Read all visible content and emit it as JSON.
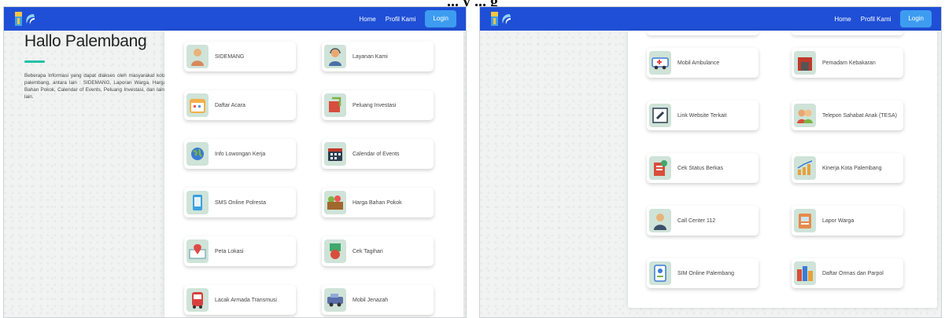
{
  "heading": "... y ... g",
  "left": {
    "nav": {
      "home": "Home",
      "profile": "Profil Kami",
      "login": "Login"
    },
    "intro": {
      "title": "Hallo Palembang",
      "text": "Beberapa Informasi yang dapat diakses oleh masyarakat kota palembang, antara lain : SIDEMANG, Laporan Warga, Harga Bahan Pokok, Calendar of Events, Peluang Investasi, dan lain-lain."
    },
    "cards": [
      {
        "label": "SIDEMANG",
        "icon": "person-icon",
        "color": "#d9895b"
      },
      {
        "label": "Layanan Kami",
        "icon": "customer-service-icon",
        "color": "#e8a870"
      },
      {
        "label": "Daftar Acara",
        "icon": "calendar-list-icon",
        "color": "#f2b04a"
      },
      {
        "label": "Peluang Investasi",
        "icon": "investment-icon",
        "color": "#d84e3c"
      },
      {
        "label": "Info Lowongan Kerja",
        "icon": "job-globe-icon",
        "color": "#3a7bd5"
      },
      {
        "label": "Calendar of Events",
        "icon": "calendar-icon",
        "color": "#c0392b"
      },
      {
        "label": "SMS Online Polresta",
        "icon": "phone-icon",
        "color": "#3aa0e0"
      },
      {
        "label": "Harga Bahan Pokok",
        "icon": "food-crate-icon",
        "color": "#7cb342"
      },
      {
        "label": "Peta Lokasi",
        "icon": "map-pin-icon",
        "color": "#e04848"
      },
      {
        "label": "Cek Tagihan",
        "icon": "bill-icon",
        "color": "#3fa86b"
      },
      {
        "label": "Lacak Armada Transmusi",
        "icon": "bus-icon",
        "color": "#d84040"
      },
      {
        "label": "Mobil Jenazah",
        "icon": "vehicle-icon",
        "color": "#5a6fa8"
      }
    ]
  },
  "right": {
    "nav": {
      "home": "Home",
      "profile": "Profil Kami",
      "login": "Login"
    },
    "cards": [
      {
        "label": "Mobil Ambulance",
        "icon": "ambulance-icon",
        "color": "#3a7bd5"
      },
      {
        "label": "Pemadam Kebakaran",
        "icon": "fire-station-icon",
        "color": "#c0392b"
      },
      {
        "label": "Link Website Terkait",
        "icon": "link-icon",
        "color": "#2c3e50"
      },
      {
        "label": "Telepon Sahabat Anak (TESA)",
        "icon": "children-icon",
        "color": "#e8a870"
      },
      {
        "label": "Cek Status Berkas",
        "icon": "document-check-icon",
        "color": "#d84e3c"
      },
      {
        "label": "Kinerja Kota Palembang",
        "icon": "growth-chart-icon",
        "color": "#e6a23c"
      },
      {
        "label": "Call Center 112",
        "icon": "operator-icon",
        "color": "#3d4f6b"
      },
      {
        "label": "Lapor Warga",
        "icon": "report-icon",
        "color": "#e58b4a"
      },
      {
        "label": "SIM Online Palembang",
        "icon": "id-card-icon",
        "color": "#3a7bd5"
      },
      {
        "label": "Daftar Ormas dan Parpol",
        "icon": "organization-icon",
        "color": "#d84e3c"
      }
    ]
  },
  "colors": {
    "navbar": "#1f4fd6",
    "login": "#3d9cf0",
    "accent": "#20c2a6",
    "icon_bg": "#cfe3d8"
  }
}
